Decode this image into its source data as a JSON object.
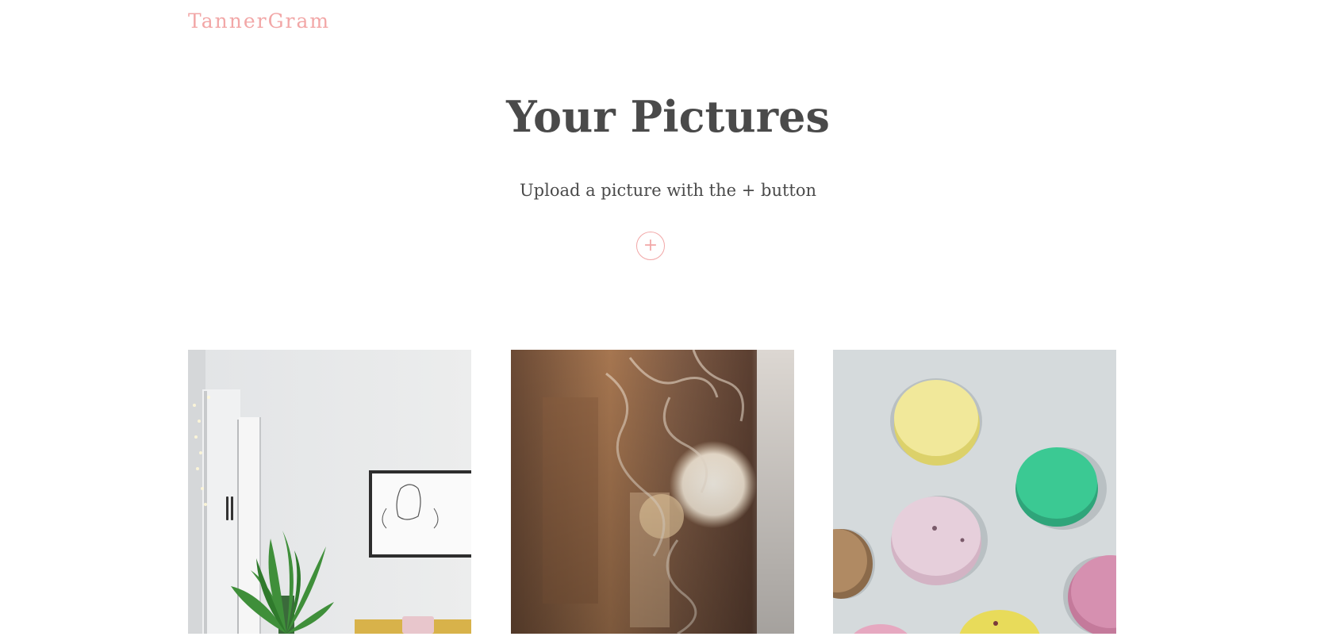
{
  "header": {
    "brand": "TannerGram"
  },
  "main": {
    "title": "Your Pictures",
    "subtitle": "Upload a picture with the + button",
    "add_button_label": "+"
  },
  "gallery": {
    "photos": [
      {
        "subject": "bright room with plant and framed sketch"
      },
      {
        "subject": "smoke over blurred warm lights"
      },
      {
        "subject": "pastel macarons on stone surface"
      }
    ]
  },
  "colors": {
    "accent": "#f2a7a7",
    "text": "#4a4a4a",
    "background": "#ffffff"
  }
}
